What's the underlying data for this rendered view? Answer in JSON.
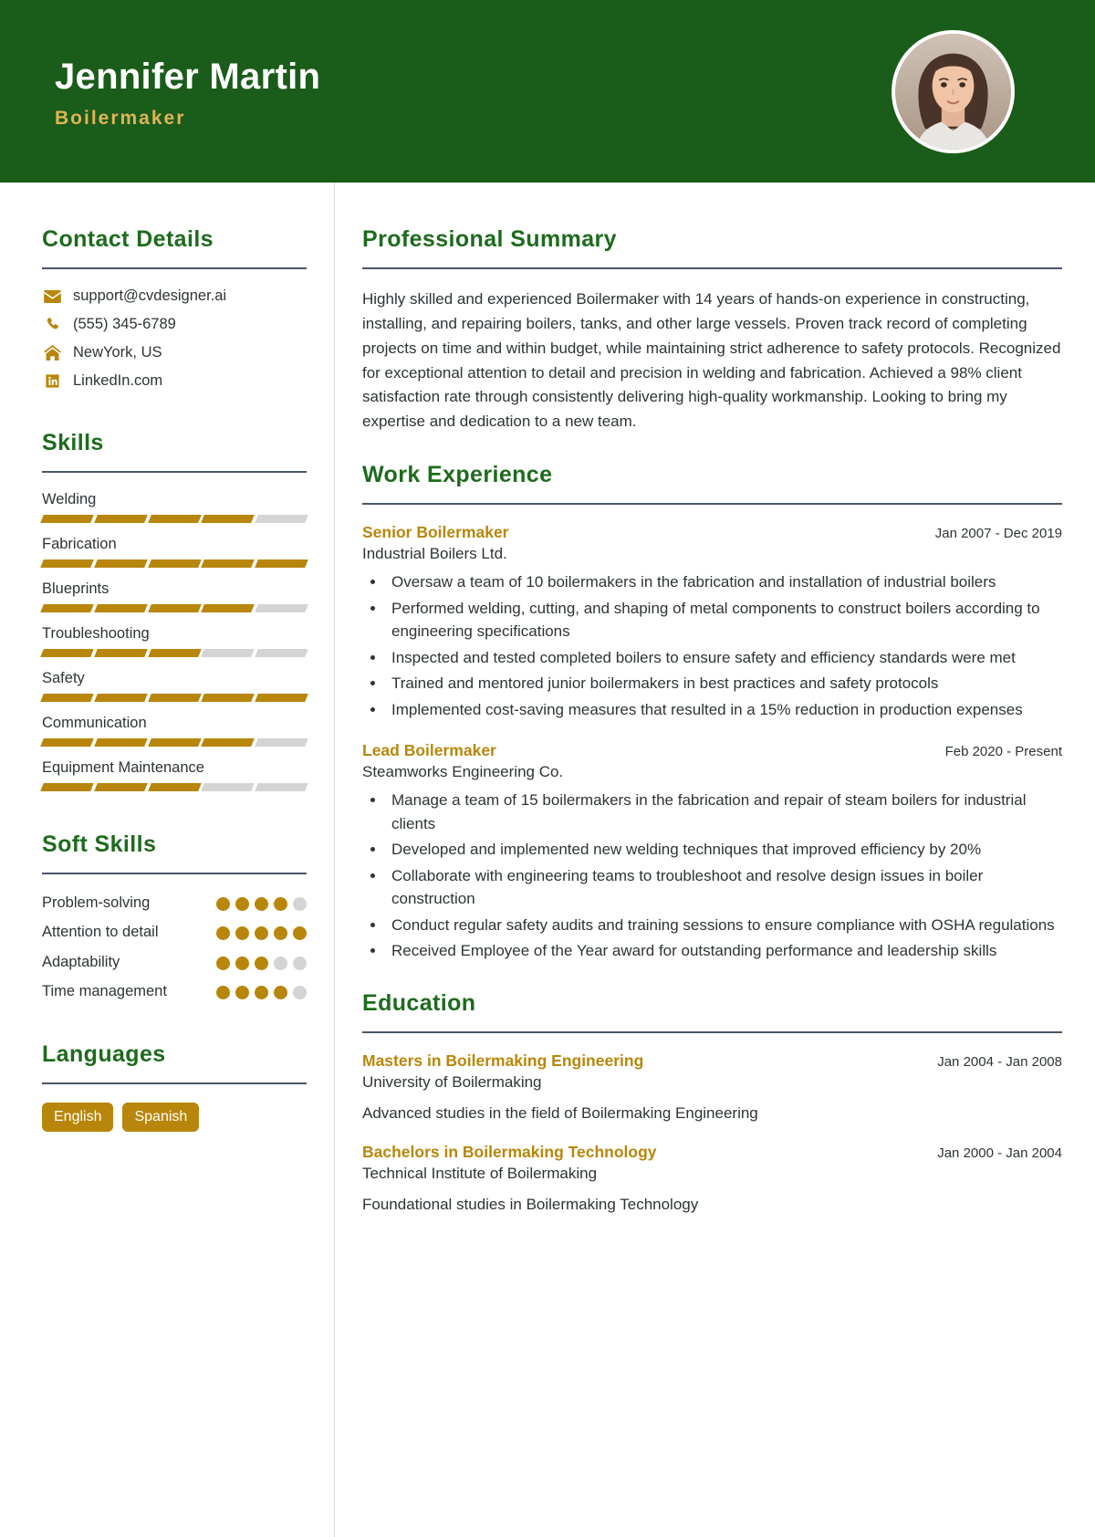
{
  "header": {
    "name": "Jennifer Martin",
    "job_title": "Boilermaker",
    "avatar_alt": "profile-photo",
    "bg_color": "#1a5c1a",
    "title_color": "#e0b455"
  },
  "theme": {
    "green": "#1d6b1d",
    "gold": "#b8860b",
    "rule": "#4a5568",
    "muted": "#d4d4d4"
  },
  "sidebar": {
    "contact": {
      "title": "Contact Details",
      "items": [
        {
          "icon": "envelope-icon",
          "text": "support@cvdesigner.ai"
        },
        {
          "icon": "phone-icon",
          "text": "(555) 345-6789"
        },
        {
          "icon": "home-icon",
          "text": "NewYork, US"
        },
        {
          "icon": "linkedin-icon",
          "text": "LinkedIn.com"
        }
      ]
    },
    "skills": {
      "title": "Skills",
      "max": 5,
      "items": [
        {
          "name": "Welding",
          "level": 4
        },
        {
          "name": "Fabrication",
          "level": 5
        },
        {
          "name": "Blueprints",
          "level": 4
        },
        {
          "name": "Troubleshooting",
          "level": 3
        },
        {
          "name": "Safety",
          "level": 5
        },
        {
          "name": "Communication",
          "level": 4
        },
        {
          "name": "Equipment Maintenance",
          "level": 3
        }
      ]
    },
    "soft_skills": {
      "title": "Soft Skills",
      "max": 5,
      "items": [
        {
          "name": "Problem-solving",
          "level": 4
        },
        {
          "name": "Attention to detail",
          "level": 5
        },
        {
          "name": "Adaptability",
          "level": 3
        },
        {
          "name": "Time management",
          "level": 4
        }
      ]
    },
    "languages": {
      "title": "Languages",
      "items": [
        "English",
        "Spanish"
      ]
    }
  },
  "main": {
    "summary": {
      "title": "Professional Summary",
      "text": "Highly skilled and experienced Boilermaker with 14 years of hands-on experience in constructing, installing, and repairing boilers, tanks, and other large vessels. Proven track record of completing projects on time and within budget, while maintaining strict adherence to safety protocols. Recognized for exceptional attention to detail and precision in welding and fabrication. Achieved a 98% client satisfaction rate through consistently delivering high-quality workmanship. Looking to bring my expertise and dedication to a new team."
    },
    "work": {
      "title": "Work Experience",
      "entries": [
        {
          "title": "Senior Boilermaker",
          "org": "Industrial Boilers Ltd.",
          "date": "Jan 2007 - Dec 2019",
          "bullets": [
            "Oversaw a team of 10 boilermakers in the fabrication and installation of industrial boilers",
            "Performed welding, cutting, and shaping of metal components to construct boilers according to engineering specifications",
            "Inspected and tested completed boilers to ensure safety and efficiency standards were met",
            "Trained and mentored junior boilermakers in best practices and safety protocols",
            "Implemented cost-saving measures that resulted in a 15% reduction in production expenses"
          ]
        },
        {
          "title": "Lead Boilermaker",
          "org": "Steamworks Engineering Co.",
          "date": "Feb 2020 - Present",
          "bullets": [
            "Manage a team of 15 boilermakers in the fabrication and repair of steam boilers for industrial clients",
            "Developed and implemented new welding techniques that improved efficiency by 20%",
            "Collaborate with engineering teams to troubleshoot and resolve design issues in boiler construction",
            "Conduct regular safety audits and training sessions to ensure compliance with OSHA regulations",
            "Received Employee of the Year award for outstanding performance and leadership skills"
          ]
        }
      ]
    },
    "education": {
      "title": "Education",
      "entries": [
        {
          "title": "Masters in Boilermaking Engineering",
          "org": "University of Boilermaking",
          "date": "Jan 2004 - Jan 2008",
          "desc": "Advanced studies in the field of Boilermaking Engineering"
        },
        {
          "title": "Bachelors in Boilermaking Technology",
          "org": "Technical Institute of Boilermaking",
          "date": "Jan 2000 - Jan 2004",
          "desc": "Foundational studies in Boilermaking Technology"
        }
      ]
    }
  }
}
